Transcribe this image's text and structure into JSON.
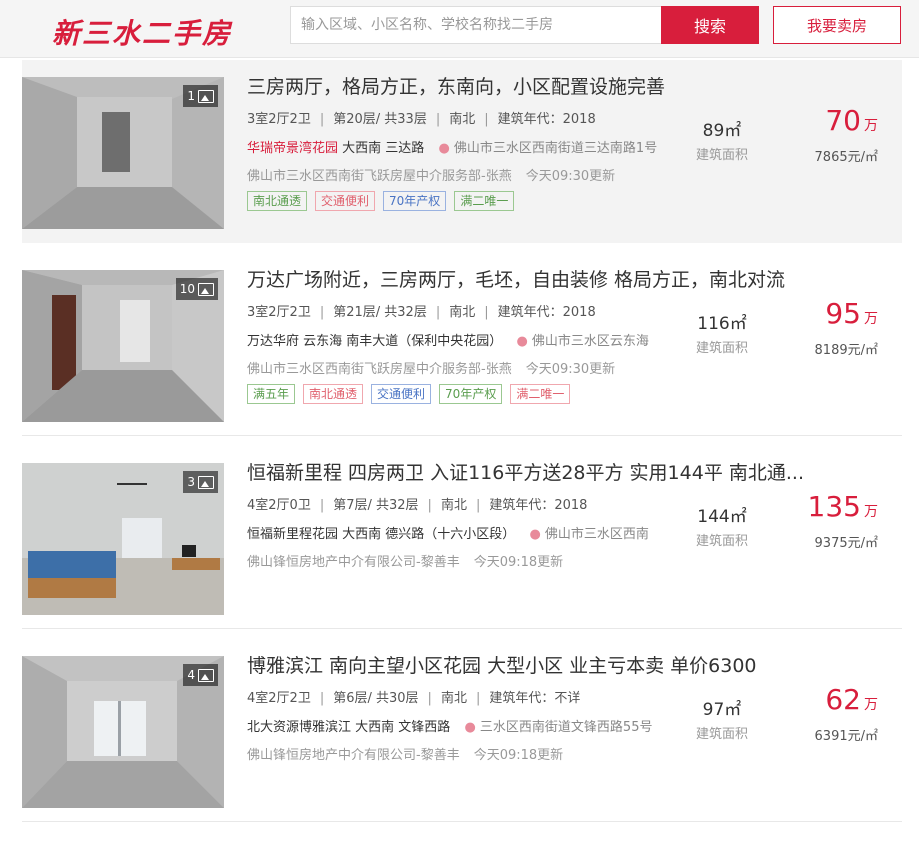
{
  "header": {
    "logo_text": "新三水二手房",
    "search_placeholder": "输入区域、小区名称、学校名称找二手房",
    "search_button": "搜索",
    "sell_button": "我要卖房"
  },
  "listings": [
    {
      "photo_count": "1",
      "title": "三房两厅，格局方正，东南向，小区配置设施完善",
      "layout": "3室2厅2卫",
      "floor": "第20层/ 共33层",
      "orientation": "南北",
      "year": "建筑年代：2018",
      "community": "华瑞帝景湾花园",
      "district": "大西南 三达路",
      "address": "佛山市三水区西南街道三达南路1号",
      "agent": "佛山市三水区西南街飞跃房屋中介服务部-张燕",
      "updated": "今天09:30更新",
      "tags": [
        {
          "text": "南北通透",
          "color": "green"
        },
        {
          "text": "交通便利",
          "color": "red"
        },
        {
          "text": "70年产权",
          "color": "blue"
        },
        {
          "text": "满二唯一",
          "color": "green"
        }
      ],
      "area": "89㎡",
      "area_label": "建筑面积",
      "price": "70",
      "price_unit": "万",
      "unit_price": "7865元/㎡"
    },
    {
      "photo_count": "10",
      "title": "万达广场附近，三房两厅，毛坯，自由装修 格局方正，南北对流",
      "layout": "3室2厅2卫",
      "floor": "第21层/ 共32层",
      "orientation": "南北",
      "year": "建筑年代：2018",
      "community": "万达华府",
      "district": "云东海 南丰大道（保利中央花园）",
      "address": "佛山市三水区云东海",
      "agent": "佛山市三水区西南街飞跃房屋中介服务部-张燕",
      "updated": "今天09:30更新",
      "tags": [
        {
          "text": "满五年",
          "color": "green"
        },
        {
          "text": "南北通透",
          "color": "red"
        },
        {
          "text": "交通便利",
          "color": "blue"
        },
        {
          "text": "70年产权",
          "color": "green"
        },
        {
          "text": "满二唯一",
          "color": "red"
        }
      ],
      "area": "116㎡",
      "area_label": "建筑面积",
      "price": "95",
      "price_unit": "万",
      "unit_price": "8189元/㎡"
    },
    {
      "photo_count": "3",
      "title": "恒福新里程 四房两卫 入证116平方送28平方 实用144平 南北通...",
      "layout": "4室2厅0卫",
      "floor": "第7层/ 共32层",
      "orientation": "南北",
      "year": "建筑年代：2018",
      "community": "恒福新里程花园",
      "district": "大西南 德兴路（十六小区段）",
      "address": "佛山市三水区西南",
      "agent": "佛山锋恒房地产中介有限公司-黎善丰",
      "updated": "今天09:18更新",
      "tags": [],
      "area": "144㎡",
      "area_label": "建筑面积",
      "price": "135",
      "price_unit": "万",
      "unit_price": "9375元/㎡"
    },
    {
      "photo_count": "4",
      "title": "博雅滨江 南向主望小区花园 大型小区 业主亏本卖 单价6300",
      "layout": "4室2厅2卫",
      "floor": "第6层/ 共30层",
      "orientation": "南北",
      "year": "建筑年代：不详",
      "community": "北大资源博雅滨江",
      "district": "大西南 文锋西路",
      "address": "三水区西南街道文锋西路55号",
      "agent": "佛山锋恒房地产中介有限公司-黎善丰",
      "updated": "今天09:18更新",
      "tags": [],
      "area": "97㎡",
      "area_label": "建筑面积",
      "price": "62",
      "price_unit": "万",
      "unit_price": "6391元/㎡"
    }
  ]
}
